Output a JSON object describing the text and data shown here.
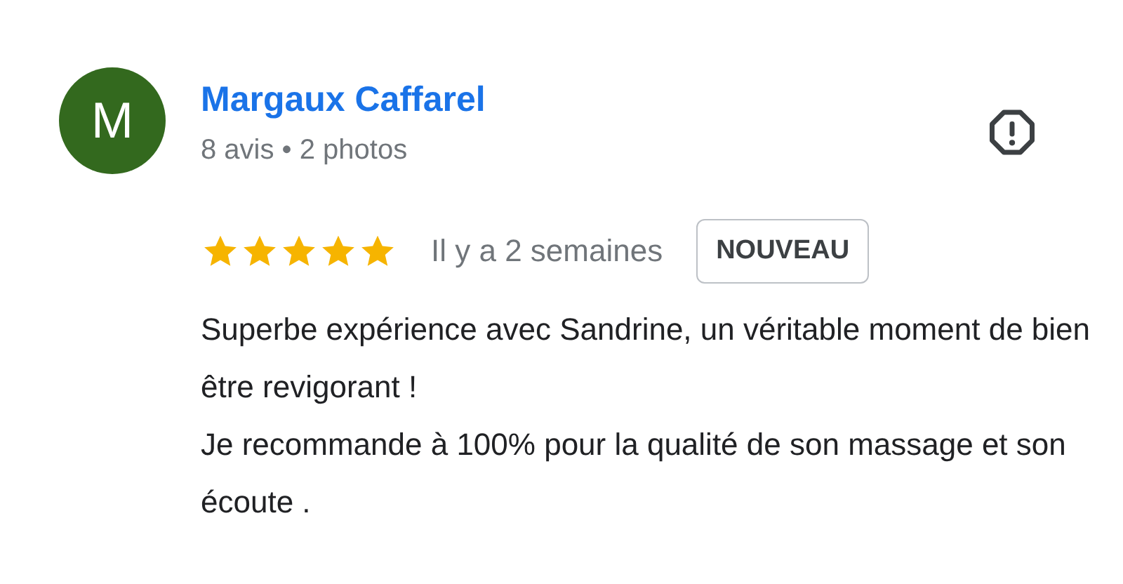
{
  "review": {
    "avatar_letter": "M",
    "author": "Margaux Caffarel",
    "meta": "8 avis • 2 photos",
    "stars": 5,
    "time": "Il y a 2 semaines",
    "badge": "NOUVEAU",
    "paragraphs": [
      "Superbe expérience avec Sandrine, un véritable moment de bien être revigorant !",
      "Je recommande à 100% pour la qualité de son massage et son écoute ."
    ]
  }
}
